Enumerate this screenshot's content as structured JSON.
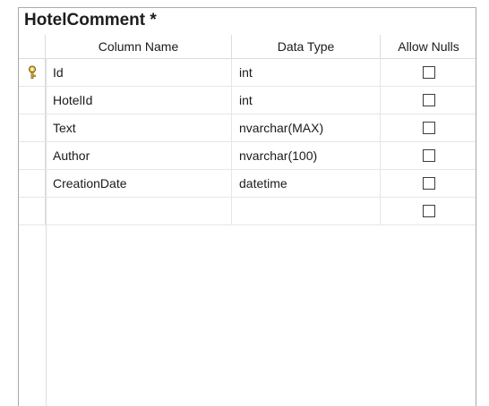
{
  "table": {
    "title": "HotelComment *",
    "columns_header": {
      "name": "Column Name",
      "type": "Data Type",
      "nulls": "Allow Nulls"
    },
    "rows": [
      {
        "name": "Id",
        "type": "int",
        "allow_nulls": false,
        "primary_key": true
      },
      {
        "name": "HotelId",
        "type": "int",
        "allow_nulls": false,
        "primary_key": false
      },
      {
        "name": "Text",
        "type": "nvarchar(MAX)",
        "allow_nulls": false,
        "primary_key": false
      },
      {
        "name": "Author",
        "type": "nvarchar(100)",
        "allow_nulls": false,
        "primary_key": false
      },
      {
        "name": "CreationDate",
        "type": "datetime",
        "allow_nulls": false,
        "primary_key": false
      },
      {
        "name": "",
        "type": "",
        "allow_nulls": false,
        "primary_key": false
      }
    ]
  },
  "icons": {
    "primary_key": "key-icon"
  }
}
